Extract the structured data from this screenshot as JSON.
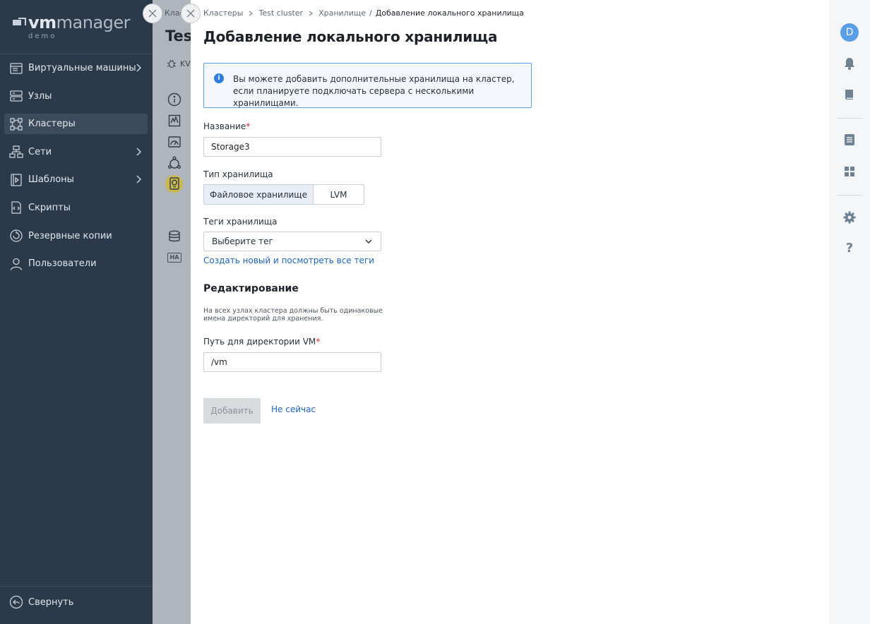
{
  "sidebar": {
    "logo_vm": "vm",
    "logo_manager": "manager",
    "logo_sub": "demo",
    "items": [
      {
        "label": "Виртуальные машины",
        "icon": "virtual-machines-icon",
        "has_chevron": true
      },
      {
        "label": "Узлы",
        "icon": "nodes-icon",
        "has_chevron": false
      },
      {
        "label": "Кластеры",
        "icon": "clusters-icon",
        "has_chevron": false,
        "active": true
      },
      {
        "label": "Сети",
        "icon": "networks-icon",
        "has_chevron": true
      },
      {
        "label": "Шаблоны",
        "icon": "templates-icon",
        "has_chevron": true
      },
      {
        "label": "Скрипты",
        "icon": "scripts-icon",
        "has_chevron": false
      },
      {
        "label": "Резервные копии",
        "icon": "backups-icon",
        "has_chevron": false
      },
      {
        "label": "Пользователи",
        "icon": "users-icon",
        "has_chevron": false
      }
    ],
    "collapse_label": "Свернуть"
  },
  "background_page": {
    "crumb": "Клас",
    "title": "Tes",
    "kvm": "KV"
  },
  "drawer": {
    "breadcrumbs": {
      "item1": "Кластеры",
      "item2": "Test cluster",
      "item3": "Хранилище",
      "current": "Добавление локального хранилища"
    },
    "title": "Добавление локального хранилища",
    "info_line1": "Вы можете добавить дополнительные хранилища на кластер,",
    "info_line2": "если планируете подключать сервера с несколькими хранилищами.",
    "name_label": "Название",
    "name_value": "Storage3",
    "type_label": "Тип хранилища",
    "type_options": [
      "Файловое хранилище",
      "LVM"
    ],
    "type_selected": "Файловое хранилище",
    "tags_label": "Теги хранилища",
    "tags_placeholder": "Выберите тег",
    "tags_link": "Создать новый и посмотреть все теги",
    "section_title": "Редактирование",
    "hint_line1": "На всех узлах кластера должны быть одинаковые",
    "hint_line2": "имена директорий для хранения.",
    "path_label": "Путь для директории VM",
    "path_value": "/vm",
    "required_mark": "*",
    "add_button": "Добавить",
    "cancel_link": "Не сейчас"
  },
  "rail": {
    "avatar_letter": "D"
  },
  "colors": {
    "sidebar_bg": "#2b3a4a",
    "accent_blue": "#2f7de1",
    "link_blue": "#1d63c4",
    "required_red": "#d8272f",
    "rail_icon": "#6e8294"
  }
}
